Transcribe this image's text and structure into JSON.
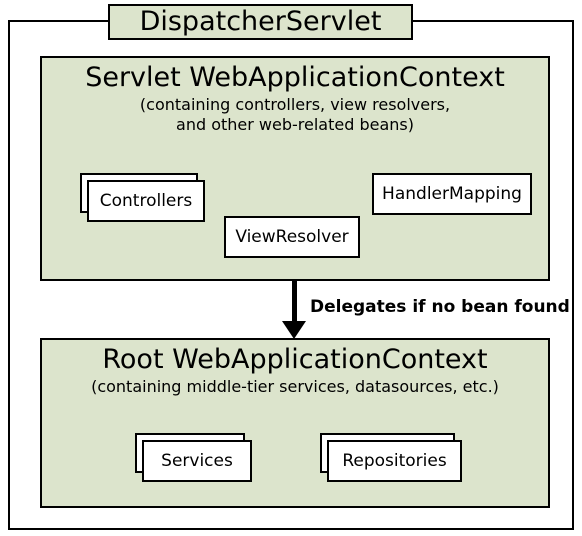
{
  "title": "DispatcherServlet",
  "servlet_context": {
    "heading": "Servlet WebApplicationContext",
    "subtitle_line1": "(containing controllers, view resolvers,",
    "subtitle_line2": "and other web-related beans)",
    "beans": {
      "controllers": "Controllers",
      "view_resolver": "ViewResolver",
      "handler_mapping": "HandlerMapping"
    }
  },
  "delegation_label": "Delegates if no bean found",
  "root_context": {
    "heading": "Root WebApplicationContext",
    "subtitle": "(containing middle-tier services, datasources, etc.)",
    "beans": {
      "services": "Services",
      "repositories": "Repositories"
    }
  }
}
